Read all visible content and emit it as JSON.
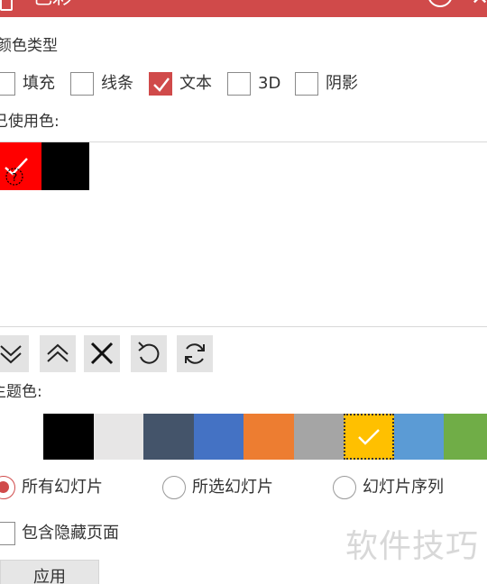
{
  "window": {
    "title": "色彩",
    "help_label": "?",
    "close_label": "✕"
  },
  "color_type": {
    "heading": "颜色类型",
    "options": [
      {
        "label": "填充",
        "checked": false
      },
      {
        "label": "线条",
        "checked": false
      },
      {
        "label": "文本",
        "checked": true
      },
      {
        "label": "3D",
        "checked": false
      },
      {
        "label": "阴影",
        "checked": false
      }
    ]
  },
  "used_colors": {
    "heading": "已使用色:",
    "swatches": [
      {
        "color": "#ff0000",
        "selected": true
      },
      {
        "color": "#000000",
        "selected": false
      }
    ]
  },
  "toolbar": {
    "buttons": [
      {
        "icon": "double-chevron-down-icon"
      },
      {
        "icon": "double-chevron-up-icon"
      },
      {
        "icon": "close-x-icon"
      },
      {
        "icon": "undo-icon"
      },
      {
        "icon": "refresh-icon"
      }
    ]
  },
  "theme_colors": {
    "heading": "主题色:",
    "swatches": [
      {
        "color": "#ffffff",
        "selected": false
      },
      {
        "color": "#000000",
        "selected": false
      },
      {
        "color": "#e7e6e6",
        "selected": false
      },
      {
        "color": "#44546a",
        "selected": false
      },
      {
        "color": "#4472c4",
        "selected": false
      },
      {
        "color": "#ed7d31",
        "selected": false
      },
      {
        "color": "#a5a5a5",
        "selected": false
      },
      {
        "color": "#ffc000",
        "selected": true
      },
      {
        "color": "#5b9bd5",
        "selected": false
      },
      {
        "color": "#70ad47",
        "selected": false
      }
    ]
  },
  "scope": {
    "options": [
      {
        "label": "所有幻灯片",
        "selected": true
      },
      {
        "label": "所选幻灯片",
        "selected": false
      },
      {
        "label": "幻灯片序列",
        "selected": false
      }
    ]
  },
  "include_hidden": {
    "label": "包含隐藏页面",
    "checked": false
  },
  "apply_button": {
    "label": "应用"
  },
  "watermark": {
    "text": "软件技巧"
  },
  "accent_color": "#d04a4a"
}
